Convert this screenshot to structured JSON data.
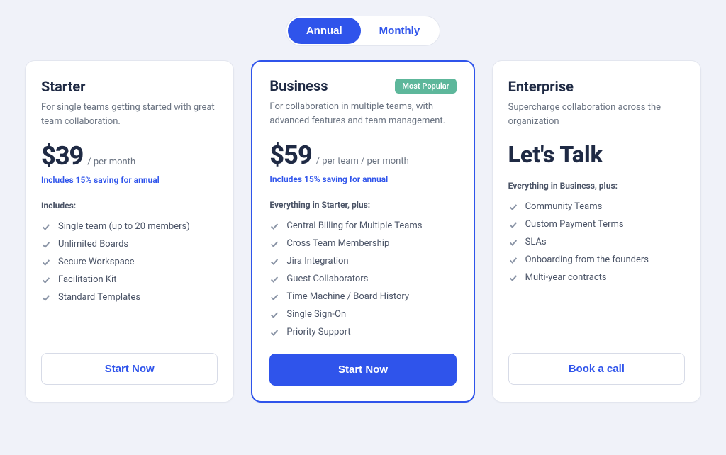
{
  "toggle": {
    "annual": "Annual",
    "monthly": "Monthly"
  },
  "plans": {
    "starter": {
      "title": "Starter",
      "desc": "For single teams getting started with great team collaboration.",
      "price": "$39",
      "unit": "/ per month",
      "savings": "Includes 15% saving for annual",
      "features_title": "Includes:",
      "features": [
        "Single team (up to 20 members)",
        "Unlimited Boards",
        "Secure Workspace",
        "Facilitation Kit",
        "Standard Templates"
      ],
      "cta": "Start Now"
    },
    "business": {
      "title": "Business",
      "badge": "Most Popular",
      "desc": "For collaboration in multiple teams, with advanced features and team management.",
      "price": "$59",
      "unit": "/ per team / per month",
      "savings": "Includes 15% saving for annual",
      "features_title": "Everything in Starter, plus:",
      "features": [
        "Central Billing for Multiple Teams",
        "Cross Team Membership",
        "Jira Integration",
        "Guest Collaborators",
        "Time Machine / Board History",
        "Single Sign-On",
        "Priority Support"
      ],
      "cta": "Start Now"
    },
    "enterprise": {
      "title": "Enterprise",
      "desc": "Supercharge collaboration across the organization",
      "talk": "Let's Talk",
      "features_title": "Everything in Business, plus:",
      "features": [
        "Community Teams",
        "Custom Payment Terms",
        "SLAs",
        "Onboarding from the founders",
        "Multi-year contracts"
      ],
      "cta": "Book a call"
    }
  }
}
